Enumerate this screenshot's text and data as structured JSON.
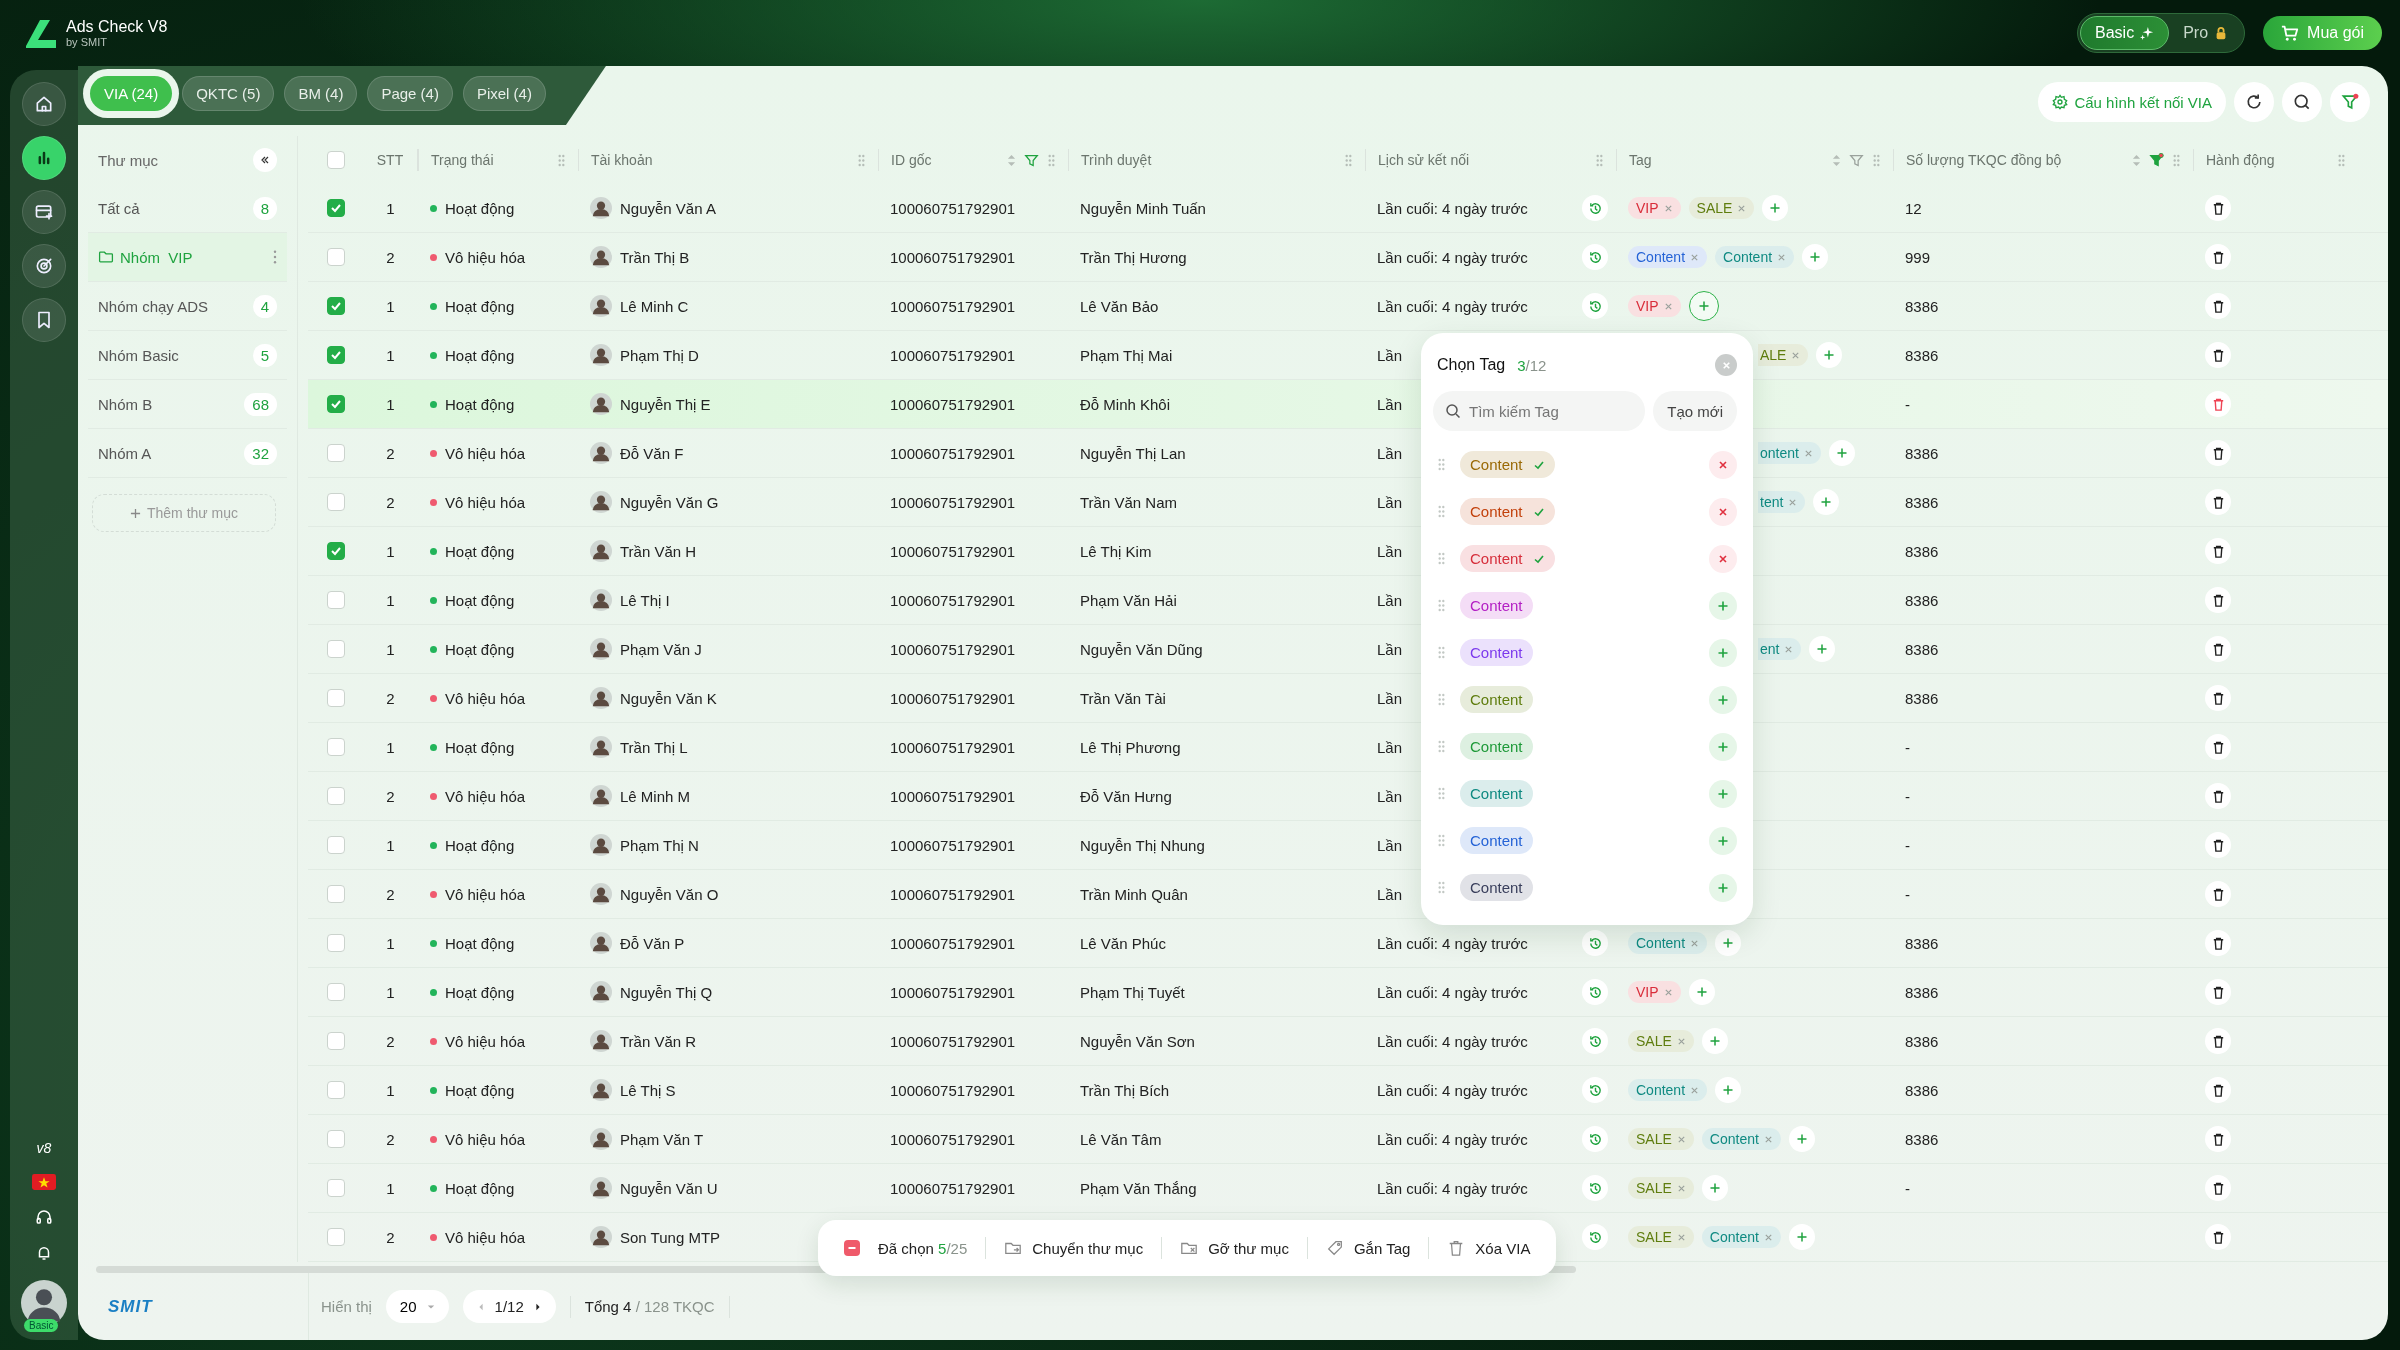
{
  "app": {
    "title": "Ads Check V8",
    "subtitle": "by SMIT"
  },
  "plans": [
    {
      "label": "Basic",
      "kind": "sparkle",
      "selected": true
    },
    {
      "label": "Pro",
      "kind": "lock",
      "selected": false
    }
  ],
  "buy_button": "Mua gói",
  "rail": {
    "items": [
      {
        "kind": "home",
        "selected": false
      },
      {
        "kind": "stats",
        "selected": true
      },
      {
        "kind": "card",
        "selected": false
      },
      {
        "kind": "target",
        "selected": false
      },
      {
        "kind": "bookmark",
        "selected": false
      }
    ],
    "version": "v8",
    "plan_badge": "Basic"
  },
  "tabs": [
    {
      "label": "VIA (24)",
      "selected": true
    },
    {
      "label": "QKTC (5)",
      "selected": false
    },
    {
      "label": "BM (4)",
      "selected": false
    },
    {
      "label": "Page (4)",
      "selected": false
    },
    {
      "label": "Pixel (4)",
      "selected": false
    }
  ],
  "toolbar": {
    "config_button": "Cấu hình kết nối VIA",
    "filter_active": true
  },
  "folders": {
    "title": "Thư mục",
    "items": [
      {
        "label": "Tất cả",
        "count": "8",
        "selected": false
      },
      {
        "label": "Nhóm  VIP",
        "selected": true
      },
      {
        "label": "Nhóm chạy ADS",
        "count": "4",
        "selected": false
      },
      {
        "label": "Nhóm Basic",
        "count": "5",
        "selected": false
      },
      {
        "label": "Nhóm B",
        "count": "68",
        "selected": false
      },
      {
        "label": "Nhóm A",
        "count": "32",
        "selected": false
      }
    ],
    "add_label": "Thêm thư mục"
  },
  "table": {
    "all_checked": false,
    "columns": [
      {
        "label": "STT",
        "draggable": false,
        "sortable": false,
        "filterable": false
      },
      {
        "label": "Trạng thái",
        "draggable": true,
        "sortable": false,
        "filterable": false
      },
      {
        "label": "Tài khoản",
        "draggable": true,
        "sortable": false,
        "filterable": false
      },
      {
        "label": "ID gốc",
        "draggable": true,
        "sortable": true,
        "filterable": true,
        "filter_hover": true,
        "filtered": false
      },
      {
        "label": "Trình duyệt",
        "draggable": true,
        "sortable": false,
        "filterable": false
      },
      {
        "label": "Lịch sử kết nối",
        "draggable": true,
        "sortable": false,
        "filterable": false
      },
      {
        "label": "Tag",
        "draggable": true,
        "sortable": true,
        "filterable": true,
        "filter_hover": false,
        "filtered": false
      },
      {
        "label": "Số lượng TKQC đồng bộ",
        "draggable": true,
        "sortable": true,
        "filterable": true,
        "filtered": true
      },
      {
        "label": "Hành động",
        "draggable": true,
        "sortable": false,
        "filterable": false
      }
    ],
    "rows": [
      {
        "checked": true,
        "selected": false,
        "stt": "1",
        "status": {
          "label": "Hoạt động",
          "kind": "active"
        },
        "account": "Nguyễn Văn A",
        "id": "100060751792901",
        "browser": "Nguyễn Minh Tuấn",
        "history": "Lần cuối: 4 ngày trước",
        "history_icon": true,
        "tags": [
          {
            "label": "VIP",
            "color": "#d92d3a",
            "cut": false
          },
          {
            "label": "SALE",
            "color": "#5f7d0e",
            "cut": false
          }
        ],
        "add": true,
        "add_active": false,
        "count": "12"
      },
      {
        "checked": false,
        "selected": false,
        "stt": "2",
        "status": {
          "label": "Vô hiệu hóa",
          "kind": "disabled"
        },
        "account": "Trần Thị B",
        "id": "100060751792901",
        "browser": "Trần Thị Hương",
        "history": "Lần cuối: 4 ngày trước",
        "history_icon": true,
        "tags": [
          {
            "label": "Content",
            "color": "#2563d6",
            "cut": false
          },
          {
            "label": "Content",
            "color": "#0f8a82",
            "cut": false
          }
        ],
        "add": true,
        "add_active": false,
        "count": "999"
      },
      {
        "checked": true,
        "selected": false,
        "stt": "1",
        "status": {
          "label": "Hoạt động",
          "kind": "active"
        },
        "account": "Lê Minh C",
        "id": "100060751792901",
        "browser": "Lê Văn Bảo",
        "history": "Lần cuối: 4 ngày trước",
        "history_icon": true,
        "tags": [
          {
            "label": "VIP",
            "color": "#d92d3a",
            "cut": false
          }
        ],
        "add": true,
        "add_active": true,
        "count": "8386"
      },
      {
        "checked": true,
        "selected": false,
        "stt": "1",
        "status": {
          "label": "Hoạt động",
          "kind": "active"
        },
        "account": "Phạm Thị D",
        "id": "100060751792901",
        "browser": "Phạm Thị Mai",
        "history": "Lần",
        "history_icon": false,
        "tags": [
          {
            "label": "ALE",
            "color": "#5f7d0e",
            "cut": true
          }
        ],
        "add": true,
        "add_active": false,
        "count": "8386"
      },
      {
        "checked": true,
        "selected": true,
        "stt": "1",
        "status": {
          "label": "Hoạt động",
          "kind": "active"
        },
        "account": "Nguyễn Thị E",
        "id": "100060751792901",
        "browser": "Đỗ Minh Khôi",
        "history": "Lần",
        "history_icon": false,
        "tags": [],
        "add": false,
        "count": "-"
      },
      {
        "checked": false,
        "selected": false,
        "stt": "2",
        "status": {
          "label": "Vô hiệu hóa",
          "kind": "disabled"
        },
        "account": "Đỗ Văn F",
        "id": "100060751792901",
        "browser": "Nguyễn Thị Lan",
        "history": "Lần",
        "history_icon": false,
        "tags": [
          {
            "label": "ontent",
            "color": "#0f8a82",
            "cut": true
          }
        ],
        "add": true,
        "add_active": false,
        "count": "8386"
      },
      {
        "checked": false,
        "selected": false,
        "stt": "2",
        "status": {
          "label": "Vô hiệu hóa",
          "kind": "disabled"
        },
        "account": "Nguyễn Văn G",
        "id": "100060751792901",
        "browser": "Trần Văn Nam",
        "history": "Lần",
        "history_icon": false,
        "tags": [
          {
            "label": "tent",
            "color": "#0f8a82",
            "cut": true
          }
        ],
        "add": true,
        "add_active": false,
        "count": "8386"
      },
      {
        "checked": true,
        "selected": false,
        "stt": "1",
        "status": {
          "label": "Hoạt động",
          "kind": "active"
        },
        "account": "Trần Văn H",
        "id": "100060751792901",
        "browser": "Lê Thị Kim",
        "history": "Lần",
        "history_icon": false,
        "tags": [],
        "add": false,
        "count": "8386"
      },
      {
        "checked": false,
        "selected": false,
        "stt": "1",
        "status": {
          "label": "Hoạt động",
          "kind": "active"
        },
        "account": "Lê Thị I",
        "id": "100060751792901",
        "browser": "Phạm Văn Hải",
        "history": "Lần",
        "history_icon": false,
        "tags": [],
        "add": false,
        "count": "8386"
      },
      {
        "checked": false,
        "selected": false,
        "stt": "1",
        "status": {
          "label": "Hoạt động",
          "kind": "active"
        },
        "account": "Phạm Văn J",
        "id": "100060751792901",
        "browser": "Nguyễn Văn Dũng",
        "history": "Lần",
        "history_icon": false,
        "tags": [
          {
            "label": "ent",
            "color": "#0f8a82",
            "cut": true
          }
        ],
        "add": true,
        "add_active": false,
        "count": "8386"
      },
      {
        "checked": false,
        "selected": false,
        "stt": "2",
        "status": {
          "label": "Vô hiệu hóa",
          "kind": "disabled"
        },
        "account": "Nguyễn Văn K",
        "id": "100060751792901",
        "browser": "Trần Văn Tài",
        "history": "Lần",
        "history_icon": false,
        "tags": [],
        "add": false,
        "count": "8386"
      },
      {
        "checked": false,
        "selected": false,
        "stt": "1",
        "status": {
          "label": "Hoạt động",
          "kind": "active"
        },
        "account": "Trần Thị L",
        "id": "100060751792901",
        "browser": "Lê Thị Phương",
        "history": "Lần",
        "history_icon": false,
        "tags": [],
        "add": false,
        "count": "-"
      },
      {
        "checked": false,
        "selected": false,
        "stt": "2",
        "status": {
          "label": "Vô hiệu hóa",
          "kind": "disabled"
        },
        "account": "Lê Minh M",
        "id": "100060751792901",
        "browser": "Đỗ Văn Hưng",
        "history": "Lần",
        "history_icon": false,
        "tags": [],
        "add": false,
        "count": "-"
      },
      {
        "checked": false,
        "selected": false,
        "stt": "1",
        "status": {
          "label": "Hoạt động",
          "kind": "active"
        },
        "account": "Phạm Thị N",
        "id": "100060751792901",
        "browser": "Nguyễn Thị Nhung",
        "history": "Lần",
        "history_icon": false,
        "tags": [],
        "add": false,
        "count": "-"
      },
      {
        "checked": false,
        "selected": false,
        "stt": "2",
        "status": {
          "label": "Vô hiệu hóa",
          "kind": "disabled"
        },
        "account": "Nguyễn Văn O",
        "id": "100060751792901",
        "browser": "Trần Minh Quân",
        "history": "Lần",
        "history_icon": false,
        "tags": [],
        "add": false,
        "count": "-"
      },
      {
        "checked": false,
        "selected": false,
        "stt": "1",
        "status": {
          "label": "Hoạt động",
          "kind": "active"
        },
        "account": "Đỗ Văn P",
        "id": "100060751792901",
        "browser": "Lê Văn Phúc",
        "history": "Lần cuối: 4 ngày trước",
        "history_icon": true,
        "tags": [
          {
            "label": "Content",
            "color": "#0f8a82",
            "cut": false
          }
        ],
        "add": true,
        "add_active": false,
        "count": "8386"
      },
      {
        "checked": false,
        "selected": false,
        "stt": "1",
        "status": {
          "label": "Hoạt động",
          "kind": "active"
        },
        "account": "Nguyễn Thị Q",
        "id": "100060751792901",
        "browser": "Phạm Thị Tuyết",
        "history": "Lần cuối: 4 ngày trước",
        "history_icon": true,
        "tags": [
          {
            "label": "VIP",
            "color": "#d92d3a",
            "cut": false
          }
        ],
        "add": true,
        "add_active": false,
        "count": "8386"
      },
      {
        "checked": false,
        "selected": false,
        "stt": "2",
        "status": {
          "label": "Vô hiệu hóa",
          "kind": "disabled"
        },
        "account": "Trần Văn R",
        "id": "100060751792901",
        "browser": "Nguyễn Văn Sơn",
        "history": "Lần cuối: 4 ngày trước",
        "history_icon": true,
        "tags": [
          {
            "label": "SALE",
            "color": "#5f7d0e",
            "cut": false
          }
        ],
        "add": true,
        "add_active": false,
        "count": "8386"
      },
      {
        "checked": false,
        "selected": false,
        "stt": "1",
        "status": {
          "label": "Hoạt động",
          "kind": "active"
        },
        "account": "Lê Thị S",
        "id": "100060751792901",
        "browser": "Trần Thị Bích",
        "history": "Lần cuối: 4 ngày trước",
        "history_icon": true,
        "tags": [
          {
            "label": "Content",
            "color": "#0f8a82",
            "cut": false
          }
        ],
        "add": true,
        "add_active": false,
        "count": "8386"
      },
      {
        "checked": false,
        "selected": false,
        "stt": "2",
        "status": {
          "label": "Vô hiệu hóa",
          "kind": "disabled"
        },
        "account": "Phạm Văn T",
        "id": "100060751792901",
        "browser": "Lê Văn Tâm",
        "history": "Lần cuối: 4 ngày trước",
        "history_icon": true,
        "tags": [
          {
            "label": "SALE",
            "color": "#5f7d0e",
            "cut": false
          },
          {
            "label": "Content",
            "color": "#0f8a82",
            "cut": false
          }
        ],
        "add": true,
        "add_active": false,
        "count": "8386"
      },
      {
        "checked": false,
        "selected": false,
        "stt": "1",
        "status": {
          "label": "Hoạt động",
          "kind": "active"
        },
        "account": "Nguyễn Văn U",
        "id": "100060751792901",
        "browser": "Phạm Văn Thắng",
        "history": "Lần cuối: 4 ngày trước",
        "history_icon": true,
        "tags": [
          {
            "label": "SALE",
            "color": "#5f7d0e",
            "cut": false
          }
        ],
        "add": true,
        "add_active": false,
        "count": "-"
      },
      {
        "checked": false,
        "selected": false,
        "stt": "2",
        "status": {
          "label": "Vô hiệu hóa",
          "kind": "disabled"
        },
        "account": "Son Tung MTP",
        "history_icon": true,
        "tags": [
          {
            "label": "SALE",
            "color": "#5f7d0e",
            "cut": false
          },
          {
            "label": "Content",
            "color": "#0f8a82",
            "cut": false
          }
        ],
        "add": true,
        "add_active": false
      }
    ]
  },
  "tag_picker": {
    "title": "Chọn Tag",
    "picked": "3",
    "total": "/12",
    "search_placeholder": "Tìm kiếm Tag",
    "create_button": "Tạo mới",
    "items": [
      {
        "label": "Content",
        "color": "#9a6a06",
        "checked": true
      },
      {
        "label": "Content",
        "color": "#c2410c",
        "checked": true
      },
      {
        "label": "Content",
        "color": "#d62f3c",
        "checked": true
      },
      {
        "label": "Content",
        "color": "#b31fc4",
        "checked": false
      },
      {
        "label": "Content",
        "color": "#7c3aed",
        "checked": false
      },
      {
        "label": "Content",
        "color": "#5f7d0e",
        "checked": false
      },
      {
        "label": "Content",
        "color": "#1f9a3a",
        "checked": false
      },
      {
        "label": "Content",
        "color": "#0f8a82",
        "checked": false
      },
      {
        "label": "Content",
        "color": "#2563d6",
        "checked": false
      },
      {
        "label": "Content",
        "color": "#3a3f5c",
        "checked": false
      }
    ]
  },
  "bulk": {
    "label": "Đã chọn",
    "picked": "5",
    "total": "/25",
    "actions": [
      {
        "label": "Chuyển thư mục",
        "kind": "move"
      },
      {
        "label": "Gỡ thư mục",
        "kind": "remove"
      },
      {
        "label": "Gắn Tag",
        "kind": "tag"
      },
      {
        "label": "Xóa VIA",
        "kind": "delete"
      }
    ]
  },
  "footer": {
    "logo": "SMIT",
    "show_label": "Hiển thị",
    "page_size": "20",
    "page": "1/12",
    "total": "Tổng 4",
    "total_rest": "/ 128 TKQC"
  }
}
